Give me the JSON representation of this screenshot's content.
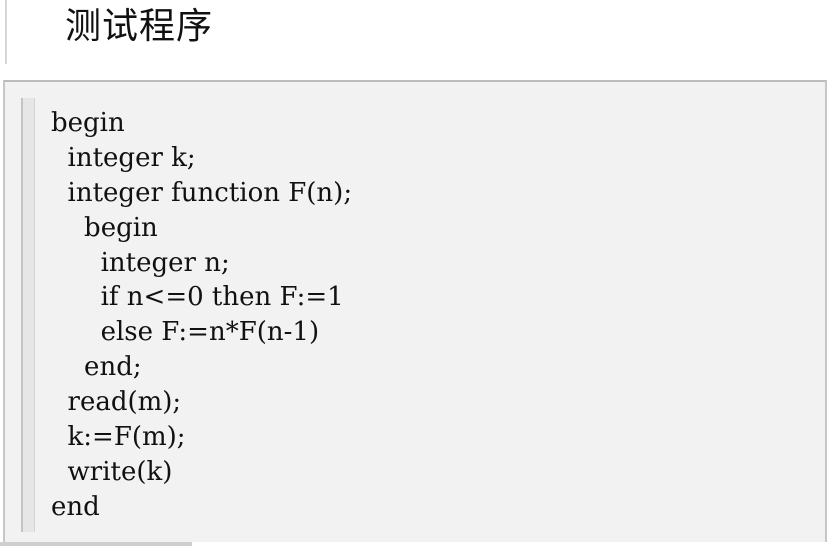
{
  "heading": {
    "title": "测试程序"
  },
  "code": {
    "lines": [
      "begin",
      "  integer k;",
      "  integer function F(n);",
      "    begin",
      "      integer n;",
      "      if n<=0 then F:=1",
      "      else F:=n*F(n-1)",
      "    end;",
      "  read(m);",
      "  k:=F(m);",
      "  write(k)",
      "end"
    ]
  }
}
